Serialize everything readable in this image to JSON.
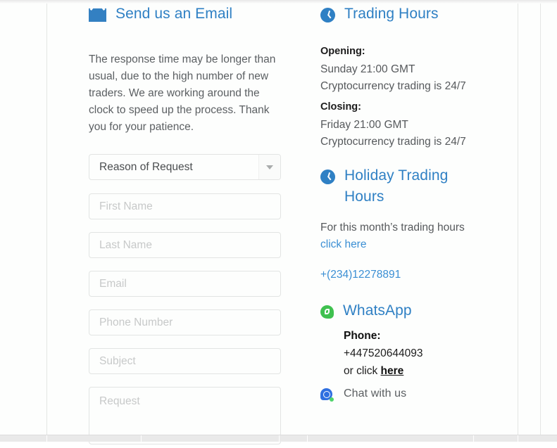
{
  "email_section": {
    "icon": "mail-icon",
    "heading": "Send us an Email",
    "intro": "The response time may be longer than usual, due to the high number of new traders. We are working around the clock to speed up the process. Thank you for your patience.",
    "form": {
      "reason_select": {
        "selected": "Reason of Request",
        "arrow_icon": "chevron-down-icon"
      },
      "first_name_placeholder": "First Name",
      "last_name_placeholder": "Last Name",
      "email_placeholder": "Email",
      "phone_placeholder": "Phone Number",
      "subject_placeholder": "Subject",
      "request_placeholder": "Request",
      "first_name_value": "",
      "last_name_value": "",
      "email_value": "",
      "phone_value": "",
      "subject_value": "",
      "request_value": ""
    }
  },
  "trading_hours": {
    "icon": "clock-icon",
    "heading": "Trading Hours",
    "opening_label": "Opening:",
    "opening_time": "Sunday 21:00 GMT",
    "opening_note": "Cryptocurrency trading is 24/7",
    "closing_label": "Closing:",
    "closing_time": "Friday 21:00 GMT",
    "closing_note": "Cryptocurrency trading is 24/7"
  },
  "holiday_hours": {
    "icon": "clock-icon",
    "heading": "Holiday Trading Hours",
    "description": "For this month’s trading hours",
    "link_label": "click here",
    "phone_link": "+(234)12278891"
  },
  "whatsapp": {
    "icon": "whatsapp-icon",
    "heading": "WhatsApp",
    "phone_label": "Phone:",
    "phone_number": "+447520644093",
    "or_click_prefix": "or click ",
    "or_click_link": "here"
  },
  "chat": {
    "icon": "chat-icon",
    "label": "Chat with us"
  },
  "colors": {
    "brand_blue": "#2f80c4",
    "link_blue": "#3b8fd4",
    "whatsapp_green": "#3fc14f",
    "chat_blue": "#2f6fe0",
    "chat_dot_green": "#4fd36a",
    "body_text": "#56595c",
    "page_bg": "#fdfefd",
    "field_border": "#e2e4e3"
  }
}
